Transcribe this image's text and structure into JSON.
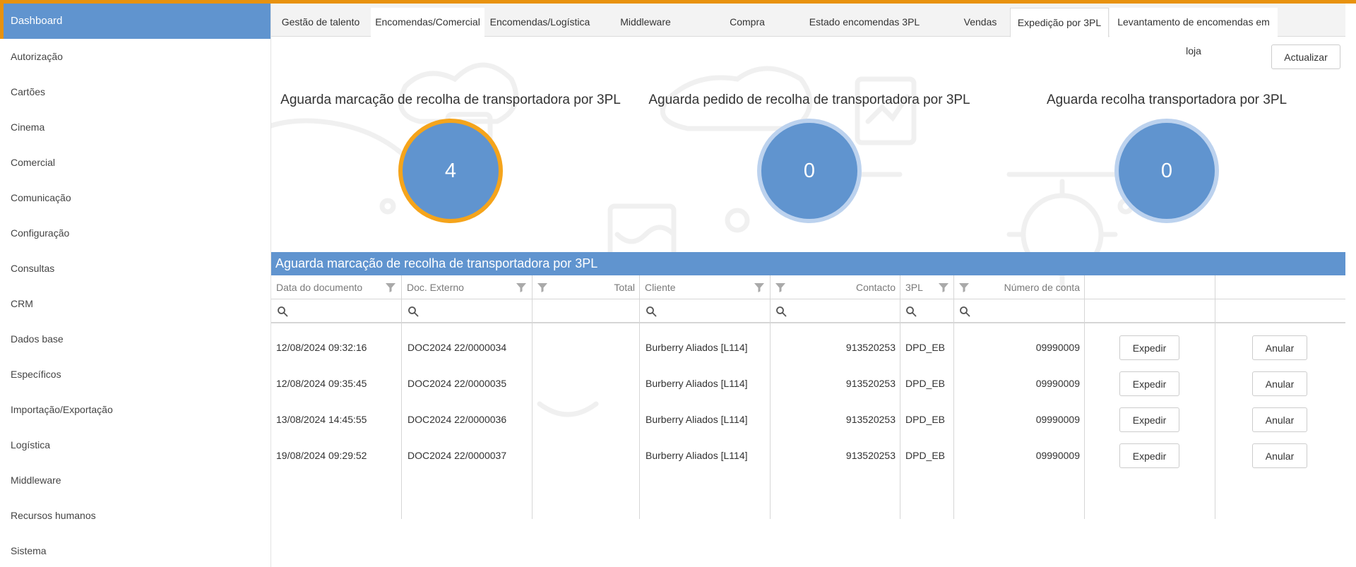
{
  "sidebar": {
    "items": [
      {
        "label": "Dashboard"
      },
      {
        "label": "Autorização"
      },
      {
        "label": "Cartões"
      },
      {
        "label": "Cinema"
      },
      {
        "label": "Comercial"
      },
      {
        "label": "Comunicação"
      },
      {
        "label": "Configuração"
      },
      {
        "label": "Consultas"
      },
      {
        "label": "CRM"
      },
      {
        "label": "Dados base"
      },
      {
        "label": "Específicos"
      },
      {
        "label": "Importação/Exportação"
      },
      {
        "label": "Logística"
      },
      {
        "label": "Middleware"
      },
      {
        "label": "Recursos humanos"
      },
      {
        "label": "Sistema"
      }
    ]
  },
  "tabs": [
    {
      "label": "Gestão de talento"
    },
    {
      "label": "Encomendas/Comercial"
    },
    {
      "label": "Encomendas/Logística"
    },
    {
      "label": "Middleware"
    },
    {
      "label": "Compra"
    },
    {
      "label": "Estado encomendas 3PL"
    },
    {
      "label": "Vendas"
    },
    {
      "label": "Expedição por 3PL"
    },
    {
      "label": "Levantamento de encomendas em loja"
    }
  ],
  "active_tab": "Expedição por 3PL",
  "toolbar": {
    "refresh_label": "Actualizar"
  },
  "kpis": [
    {
      "title": "Aguarda marcação de recolha de transportadora por 3PL",
      "value": "4",
      "highlighted": true
    },
    {
      "title": "Aguarda pedido de recolha de transportadora por 3PL",
      "value": "0",
      "highlighted": false
    },
    {
      "title": "Aguarda recolha transportadora por 3PL",
      "value": "0",
      "highlighted": false
    }
  ],
  "grid": {
    "title": "Aguarda marcação de recolha de transportadora por 3PL",
    "columns": [
      "Data do documento",
      "Doc. Externo",
      "Total",
      "Cliente",
      "Contacto",
      "3PL",
      "Número de conta"
    ],
    "rows": [
      {
        "date": "12/08/2024 09:32:16",
        "doc": "DOC2024 22/0000034",
        "total": "",
        "client": "Burberry Aliados [L114]",
        "contact": "913520253",
        "tpl": "DPD_EB",
        "account": "09990009"
      },
      {
        "date": "12/08/2024 09:35:45",
        "doc": "DOC2024 22/0000035",
        "total": "",
        "client": "Burberry Aliados [L114]",
        "contact": "913520253",
        "tpl": "DPD_EB",
        "account": "09990009"
      },
      {
        "date": "13/08/2024 14:45:55",
        "doc": "DOC2024 22/0000036",
        "total": "",
        "client": "Burberry Aliados [L114]",
        "contact": "913520253",
        "tpl": "DPD_EB",
        "account": "09990009"
      },
      {
        "date": "19/08/2024 09:29:52",
        "doc": "DOC2024 22/0000037",
        "total": "",
        "client": "Burberry Aliados [L114]",
        "contact": "913520253",
        "tpl": "DPD_EB",
        "account": "09990009"
      }
    ],
    "ship_label": "Expedir",
    "cancel_label": "Anular"
  },
  "colors": {
    "accent": "#6094cf",
    "highlight": "#f5a41b",
    "topbar": "#e8920e"
  }
}
